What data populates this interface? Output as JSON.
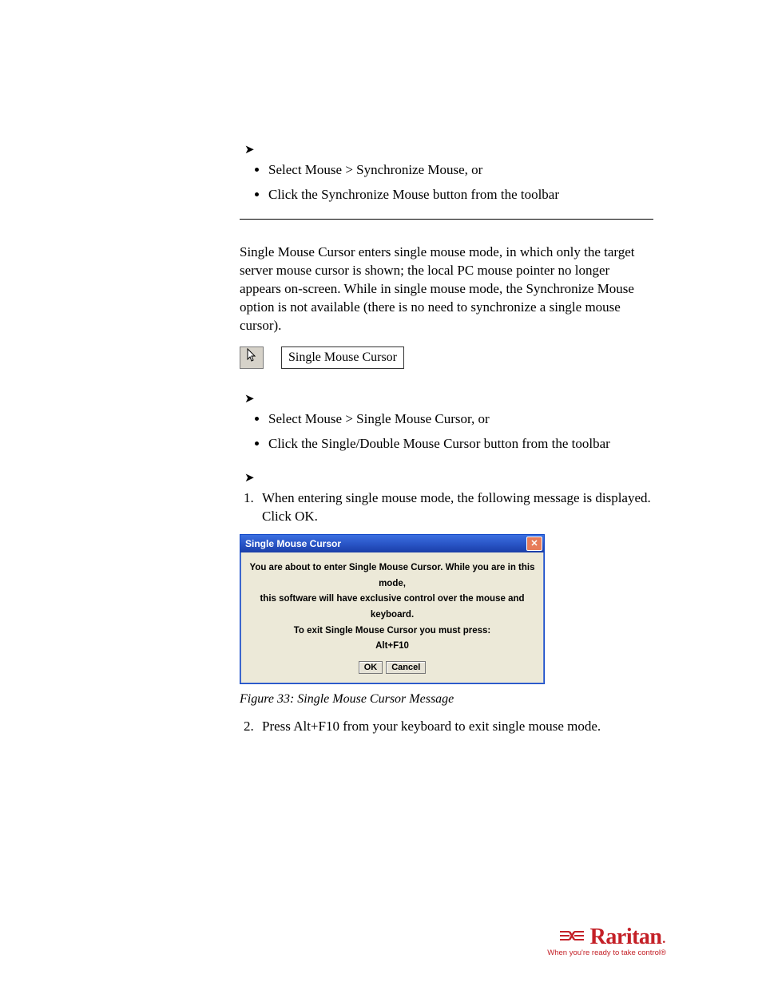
{
  "section1": {
    "bullets": [
      "Select Mouse > Synchronize Mouse, or",
      "Click the Synchronize Mouse button from the toolbar"
    ]
  },
  "paragraph1": "Single Mouse Cursor enters single mouse mode, in which only the target server mouse cursor is shown; the local PC mouse pointer no longer appears on-screen. While in single mouse mode, the Synchronize Mouse option is not available (there is no need to synchronize a single mouse cursor).",
  "icon_caption": "Single Mouse Cursor",
  "section2": {
    "bullets": [
      "Select Mouse > Single Mouse Cursor, or",
      "Click the Single/Double Mouse Cursor button from the toolbar"
    ]
  },
  "step1": "When entering single mouse mode, the following message is displayed. Click OK.",
  "dialog": {
    "title": "Single Mouse Cursor",
    "line1": "You are about to enter Single Mouse Cursor. While you are in this mode,",
    "line2": "this software will have exclusive control over the mouse and keyboard.",
    "line3": "To exit Single Mouse Cursor you must press:",
    "line4": "Alt+F10",
    "ok": "OK",
    "cancel": "Cancel"
  },
  "figure_caption": "Figure 33: Single Mouse Cursor Message",
  "step2": "Press Alt+F10 from your keyboard to exit single mouse mode.",
  "logo": {
    "brand": "Raritan",
    "tagline": "When you're ready to take control®"
  }
}
